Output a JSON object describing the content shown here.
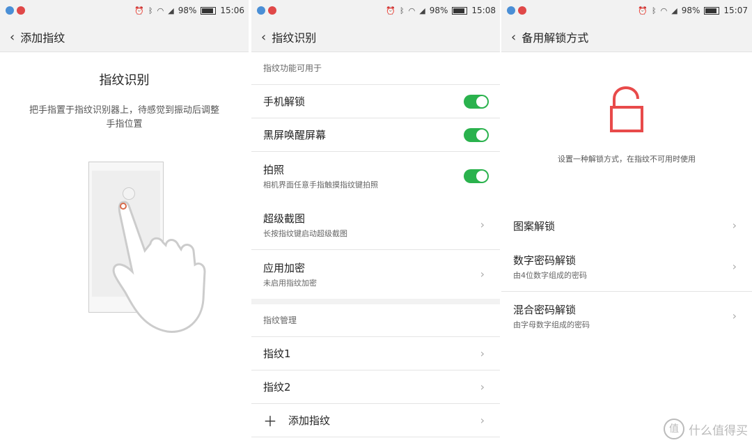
{
  "panel1": {
    "status": {
      "battery": "98%",
      "time": "15:06"
    },
    "header_title": "添加指纹",
    "title": "指纹识别",
    "description": "把手指置于指纹识别器上，待感觉到振动后调整手指位置"
  },
  "panel2": {
    "status": {
      "battery": "98%",
      "time": "15:08"
    },
    "header_title": "指纹识别",
    "section_usage": "指纹功能可用于",
    "items": [
      {
        "label": "手机解锁",
        "toggle": true
      },
      {
        "label": "黑屏唤醒屏幕",
        "toggle": true
      },
      {
        "label": "拍照",
        "sub": "相机界面任意手指触摸指纹键拍照",
        "toggle": true
      },
      {
        "label": "超级截图",
        "sub": "长按指纹键启动超级截图"
      },
      {
        "label": "应用加密",
        "sub": "未启用指纹加密"
      }
    ],
    "section_manage": "指纹管理",
    "fingerprints": [
      {
        "label": "指纹1"
      },
      {
        "label": "指纹2"
      }
    ],
    "add_label": "添加指纹"
  },
  "panel3": {
    "status": {
      "battery": "98%",
      "time": "15:07"
    },
    "header_title": "备用解锁方式",
    "description": "设置一种解锁方式，在指纹不可用时使用",
    "options": [
      {
        "label": "图案解锁"
      },
      {
        "label": "数字密码解锁",
        "sub": "由4位数字组成的密码"
      },
      {
        "label": "混合密码解锁",
        "sub": "由字母数字组成的密码"
      }
    ],
    "lock_color": "#e84a4a"
  },
  "watermark": {
    "mark": "值",
    "text": "什么值得买"
  },
  "colors": {
    "toggle_on": "#2ab24d",
    "status_bg": "#f2f2f2"
  }
}
